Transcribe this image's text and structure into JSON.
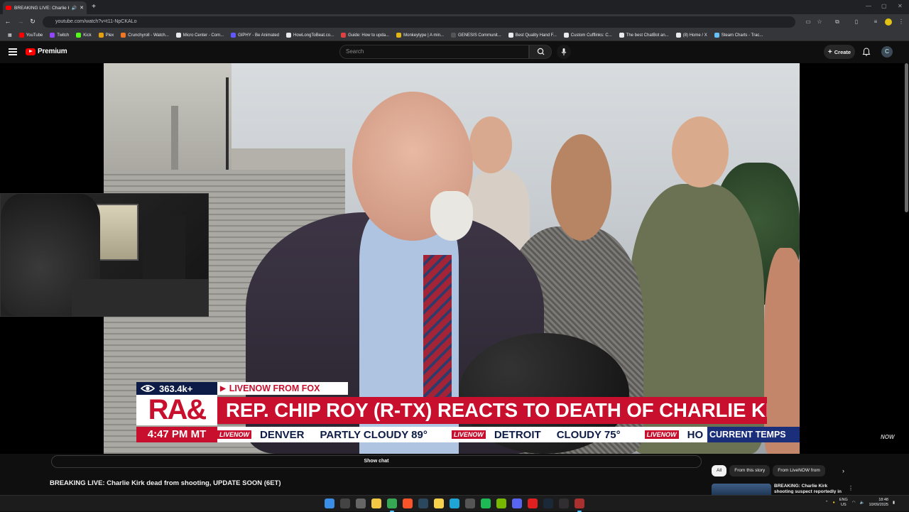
{
  "browser": {
    "tab_title": "BREAKING LIVE: Charlie Kirk",
    "new_tab_icon": "plus-icon",
    "url": "youtube.com/watch?v=t11-NpCKALo",
    "window_controls": [
      "—",
      "▢",
      "✕"
    ],
    "bookmarks": [
      {
        "label": "YouTube",
        "color": "#ff0000"
      },
      {
        "label": "Twitch",
        "color": "#9146ff"
      },
      {
        "label": "Kick",
        "color": "#53fc18"
      },
      {
        "label": "Plex",
        "color": "#e5a00d"
      },
      {
        "label": "Crunchyroll - Watch...",
        "color": "#f47521"
      },
      {
        "label": "Micro Center - Com...",
        "color": "#e8eaed"
      },
      {
        "label": "GIPHY - Be Animated",
        "color": "#6157ff"
      },
      {
        "label": "HowLongToBeat.co...",
        "color": "#e8eaed"
      },
      {
        "label": "Guide: How to upda...",
        "color": "#e04040"
      },
      {
        "label": "Monkeytype | A min...",
        "color": "#e2b714"
      },
      {
        "label": "GENESIS Communit...",
        "color": "#555555"
      },
      {
        "label": "Best Quality Hand F...",
        "color": "#e8eaed"
      },
      {
        "label": "Custom Cufflinks: C...",
        "color": "#e8eaed"
      },
      {
        "label": "The best ChatBot an...",
        "color": "#e8eaed"
      },
      {
        "label": "(8) Home / X",
        "color": "#e8eaed"
      },
      {
        "label": "Steam Charts - Trac...",
        "color": "#66c0f4"
      }
    ]
  },
  "youtube": {
    "logo_text": "Premium",
    "search_placeholder": "Search",
    "create_label": "Create",
    "avatar_letter": "C",
    "show_chat_label": "Show chat",
    "video_title": "BREAKING LIVE: Charlie Kirk dead from shooting, UPDATE SOON (6ET)",
    "chips": [
      {
        "label": "All",
        "active": true
      },
      {
        "label": "From this story",
        "active": false
      },
      {
        "label": "From LiveNOW from",
        "active": false
      }
    ],
    "rec_title": "BREAKING: Charlie Kirk shooting suspect reportedly in"
  },
  "broadcast": {
    "viewers": "363.4k+",
    "source": "LIVENOW FROM FOX",
    "show_logo": "RA&",
    "headline": "REP. CHIP ROY (R-TX) REACTS TO DEATH OF CHARLIE KIRK",
    "time": "4:47 PM MT",
    "ticker_badge": "LIVENOW",
    "ticker": [
      "DENVER",
      "PARTLY CLOUDY 89°",
      "DETROIT",
      "CLOUDY 75°",
      "HO"
    ],
    "ticker_category": "CURRENT TEMPS",
    "watermark": "NOW"
  },
  "taskbar": {
    "apps": [
      {
        "name": "start-icon",
        "color": "#3a8ee6"
      },
      {
        "name": "search-icon",
        "color": "#444444"
      },
      {
        "name": "taskview-icon",
        "color": "#666666"
      },
      {
        "name": "explorer-icon",
        "color": "#f2c744"
      },
      {
        "name": "chrome-icon",
        "color": "#34a853"
      },
      {
        "name": "brave-icon",
        "color": "#fb542b"
      },
      {
        "name": "steam-icon",
        "color": "#2a475e"
      },
      {
        "name": "notes-icon",
        "color": "#f7d24a"
      },
      {
        "name": "edge-icon",
        "color": "#1ea5d6"
      },
      {
        "name": "calculator-icon",
        "color": "#555555"
      },
      {
        "name": "spotify-icon",
        "color": "#1db954"
      },
      {
        "name": "nvidia-icon",
        "color": "#76b900"
      },
      {
        "name": "discord-icon",
        "color": "#5865f2"
      },
      {
        "name": "media-icon",
        "color": "#e02020"
      },
      {
        "name": "steam2-icon",
        "color": "#1b2838"
      },
      {
        "name": "obs-icon",
        "color": "#302e31"
      },
      {
        "name": "tool-icon",
        "color": "#aa3030"
      }
    ],
    "lang_1": "ENG",
    "lang_2": "US",
    "time": "18:48",
    "date": "10/09/2025"
  }
}
